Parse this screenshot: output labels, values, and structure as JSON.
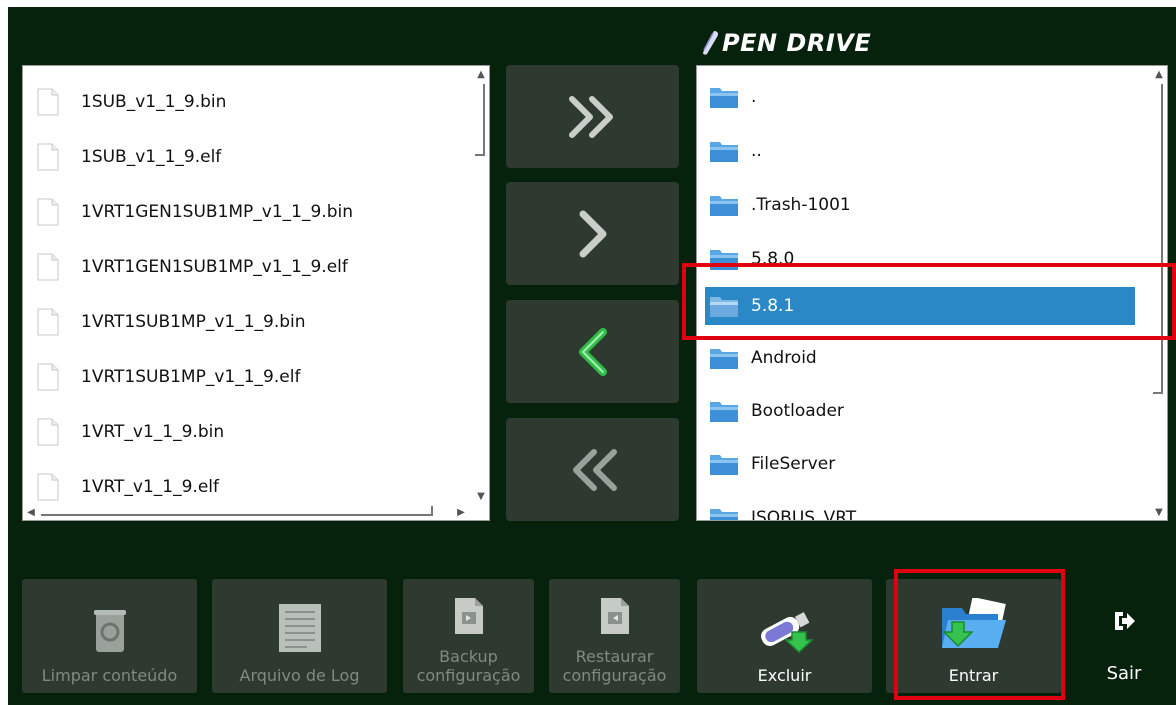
{
  "header": {
    "title": "PEN DRIVE",
    "title_icon": "pen-drive-icon"
  },
  "left_list": {
    "items": [
      {
        "label": "1SUB_v1_1_9.bin",
        "icon": "file-icon"
      },
      {
        "label": "1SUB_v1_1_9.elf",
        "icon": "file-icon"
      },
      {
        "label": "1VRT1GEN1SUB1MP_v1_1_9.bin",
        "icon": "file-icon"
      },
      {
        "label": "1VRT1GEN1SUB1MP_v1_1_9.elf",
        "icon": "file-icon"
      },
      {
        "label": "1VRT1SUB1MP_v1_1_9.bin",
        "icon": "file-icon"
      },
      {
        "label": "1VRT1SUB1MP_v1_1_9.elf",
        "icon": "file-icon"
      },
      {
        "label": "1VRT_v1_1_9.bin",
        "icon": "file-icon"
      },
      {
        "label": "1VRT_v1_1_9.elf",
        "icon": "file-icon"
      }
    ]
  },
  "right_list": {
    "selected": "5.8.1",
    "items": [
      {
        "label": ".",
        "icon": "folder-icon"
      },
      {
        "label": "..",
        "icon": "folder-icon"
      },
      {
        "label": ".Trash-1001",
        "icon": "folder-icon"
      },
      {
        "label": "5.8.0",
        "icon": "folder-icon"
      },
      {
        "label": "5.8.1",
        "icon": "folder-icon"
      },
      {
        "label": "Android",
        "icon": "folder-icon"
      },
      {
        "label": "Bootloader",
        "icon": "folder-icon"
      },
      {
        "label": "FileServer",
        "icon": "folder-icon"
      },
      {
        "label": "ISOBUS_VRT",
        "icon": "folder-icon"
      }
    ]
  },
  "transfer_buttons": [
    {
      "icon": "double-chevron-right-icon"
    },
    {
      "icon": "chevron-right-icon"
    },
    {
      "icon": "chevron-left-icon"
    },
    {
      "icon": "double-chevron-left-icon"
    }
  ],
  "toolbar": {
    "clear": {
      "label": "Limpar conteúdo",
      "icon": "recycle-bin-icon"
    },
    "log": {
      "label": "Arquivo de Log",
      "icon": "log-file-icon"
    },
    "backup": {
      "label": "Backup configuração",
      "line1": "Backup",
      "line2": "configuração",
      "icon": "backup-file-icon"
    },
    "restore": {
      "label": "Restaurar configuração",
      "line1": "Restaurar",
      "line2": "configuração",
      "icon": "restore-file-icon"
    },
    "delete": {
      "label": "Excluir",
      "icon": "usb-drive-icon"
    },
    "enter": {
      "label": "Entrar",
      "icon": "open-folder-icon"
    },
    "exit": {
      "label": "Sair",
      "icon": "exit-icon"
    }
  },
  "colors": {
    "background": "#06210c",
    "button": "#2e3a2f",
    "selection": "#2b88c6",
    "highlight": "#e1000f"
  }
}
